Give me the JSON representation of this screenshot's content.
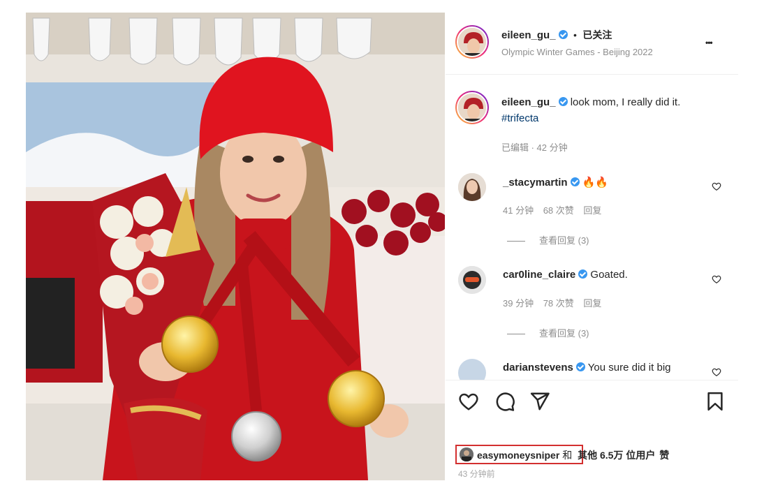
{
  "post": {
    "author": "eileen_gu_",
    "separator": "•",
    "follow_status": "已关注",
    "location": "Olympic Winter Games - Beijing 2022",
    "more": "•••"
  },
  "caption": {
    "username": "eileen_gu_",
    "text": "look mom, I really did it.",
    "hashtag": "#trifecta",
    "meta": "已编辑 · 42 分钟"
  },
  "comments": [
    {
      "username": "_stacymartin",
      "text": "🔥🔥",
      "time": "41 分钟",
      "likes": "68 次赞",
      "reply": "回复",
      "view_replies": "查看回复 (3)"
    },
    {
      "username": "car0line_claire",
      "text": "Goated.",
      "time": "39 分钟",
      "likes": "78 次赞",
      "reply": "回复",
      "view_replies": "查看回复 (3)"
    },
    {
      "username": "darianstevens",
      "text": "You sure did it big"
    }
  ],
  "likes": {
    "user": "easymoneysniper",
    "connector": "和",
    "others": "其他 6.5万 位用户",
    "suffix": "赞",
    "time": "43 分钟前"
  },
  "icons": [
    "verified-icon",
    "more-icon",
    "heart-icon",
    "comment-icon",
    "share-icon",
    "bookmark-icon"
  ],
  "colors": {
    "verified": "#3897f0",
    "highlight": "#d32f2f",
    "link": "#00376b"
  }
}
